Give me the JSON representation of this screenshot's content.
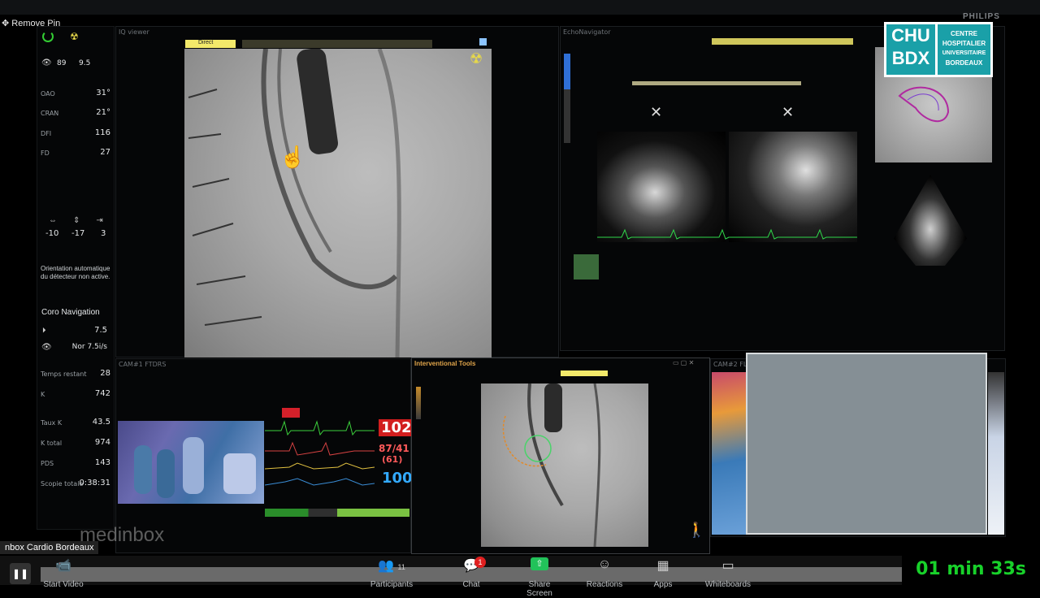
{
  "topbar": {
    "remove_pin": "Remove Pin",
    "vendor": "PHILIPS"
  },
  "logo": {
    "line1": "CHU",
    "line2": "BDX",
    "right": [
      "CENTRE",
      "HOSPITALIER",
      "UNIVERSITAIRE",
      "BORDEAUX"
    ]
  },
  "left_panel": {
    "eye_values": [
      "89",
      "9.5"
    ],
    "params": [
      {
        "label": "OAO",
        "value": "31°"
      },
      {
        "label": "CRAN",
        "value": "21°"
      },
      {
        "label": "DFI",
        "value": "116"
      },
      {
        "label": "FD",
        "value": "27"
      }
    ],
    "table_values": [
      "-10",
      "-17",
      "3"
    ],
    "orientation_note": "Orientation automatique du détecteur non active.",
    "coro_nav_title": "Coro Navigation",
    "coro_nav_values": [
      "7.5",
      "Nor 7.5i/s"
    ],
    "stats": [
      {
        "label": "Temps restant",
        "value": "28"
      },
      {
        "label": "K",
        "value": "742"
      },
      {
        "label": "Taux K",
        "value": "43.5"
      },
      {
        "label": "K total",
        "value": "974"
      },
      {
        "label": "PDS",
        "value": "143"
      },
      {
        "label": "Scopie totale",
        "value": "0:38:31"
      }
    ]
  },
  "main_view": {
    "header": "IQ viewer",
    "tag": "Direct"
  },
  "echo_view": {
    "header": "EchoNavigator"
  },
  "cam1": {
    "label": "CAM#1 FTDRS",
    "rec_label": "",
    "hr": "102",
    "bp": "87/41",
    "bp_mean": "(61)",
    "spo2": "100"
  },
  "interventional": {
    "title": "Interventional Tools"
  },
  "cam2": {
    "label": "CAM#2 FL"
  },
  "watermark": "medinbox",
  "bottom_left_label": "nbox Cardio Bordeaux",
  "badge_chat": "1",
  "toolbar": {
    "items": [
      "Start Video",
      "Participants",
      "Chat",
      "Share Screen",
      "Reactions",
      "Apps",
      "Whiteboards"
    ],
    "participants_count": "11"
  },
  "timer": "01 min 33s",
  "colors": {
    "timer": "#18d12a",
    "tag": "#f3e96a",
    "logo_bg": "#1aa0a8",
    "hr": "#ff2b2b",
    "spo2": "#33aaff"
  }
}
